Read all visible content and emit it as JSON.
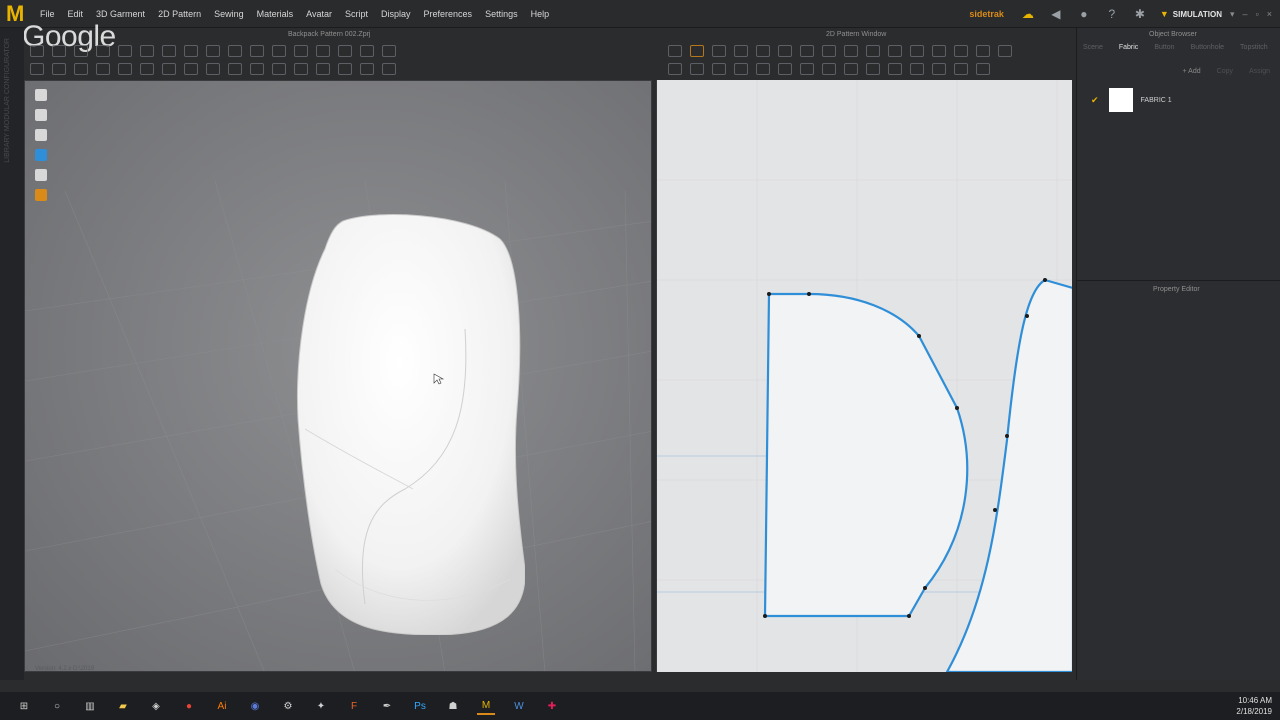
{
  "menubar": {
    "app_logo": "M",
    "items": [
      "File",
      "Edit",
      "3D Garment",
      "2D Pattern",
      "Sewing",
      "Materials",
      "Avatar",
      "Script",
      "Display",
      "Preferences",
      "Settings",
      "Help"
    ],
    "watermark": "Google",
    "user": "sidetrak",
    "mode": "SIMULATION"
  },
  "left_strip": {
    "text": "LIBRARY  MODULAR CONFIGURATOR"
  },
  "view3d": {
    "title": "Backpack Pattern 002.Zprj",
    "status": "Version: 4.2.x D:\\2019"
  },
  "view2d": {
    "title": "2D Pattern Window"
  },
  "object_browser": {
    "title": "Object Browser",
    "tabs": [
      "Scene",
      "Fabric",
      "Button",
      "Buttonhole",
      "Topstitch"
    ],
    "active_tab": "Fabric",
    "actions": [
      "+ Add",
      "Copy",
      "Assign"
    ],
    "fabric": {
      "name": "FABRIC 1",
      "checked": true
    }
  },
  "property_editor": {
    "title": "Property Editor"
  },
  "taskbar": {
    "time": "10:46 AM",
    "date": "2/18/2019"
  },
  "colors": {
    "accent": "#e8b400",
    "pattern_line": "#2f8ed8",
    "user": "#d98a18"
  }
}
